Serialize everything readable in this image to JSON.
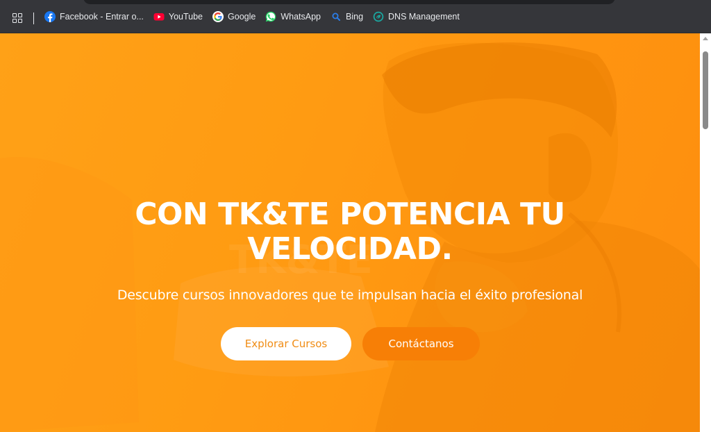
{
  "bookmarks_bar": {
    "items": [
      {
        "label": "Facebook - Entrar o...",
        "icon": "facebook-icon",
        "color": "#1877f2"
      },
      {
        "label": "YouTube",
        "icon": "youtube-icon",
        "color": "#ff0033"
      },
      {
        "label": "Google",
        "icon": "google-icon",
        "color": "#4285f4"
      },
      {
        "label": "WhatsApp",
        "icon": "whatsapp-icon",
        "color": "#25d366"
      },
      {
        "label": "Bing",
        "icon": "bing-search-icon",
        "color": "#2b7de9"
      },
      {
        "label": "DNS Management",
        "icon": "dns-management-icon",
        "color": "#1aa7a0"
      }
    ]
  },
  "hero": {
    "title_line1": "CON TK&TE POTENCIA TU",
    "title_line2": "VELOCIDAD.",
    "subtitle": "Descubre cursos innovadores que te impulsan hacia el éxito profesional",
    "primary_button": "Explorar Cursos",
    "secondary_button": "Contáctanos"
  },
  "colors": {
    "hero_overlay": "#ff9a12",
    "accent": "#f08c14",
    "secondary_button": "#f77f06",
    "browser_chrome": "#35363a"
  }
}
